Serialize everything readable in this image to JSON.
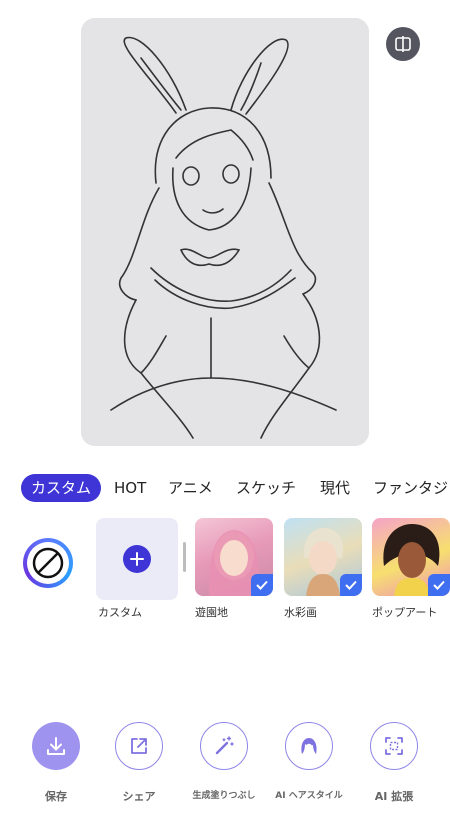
{
  "tabs": [
    {
      "label": "カスタム",
      "active": true
    },
    {
      "label": "HOT"
    },
    {
      "label": "アニメ"
    },
    {
      "label": "スケッチ"
    },
    {
      "label": "現代"
    },
    {
      "label": "ファンタジ"
    }
  ],
  "styles": {
    "none_icon": "no-style-icon",
    "custom_label": "カスタム",
    "items": [
      {
        "label": "遊園地",
        "selected": true
      },
      {
        "label": "水彩画",
        "selected": true
      },
      {
        "label": "ポップアート",
        "selected": true
      }
    ]
  },
  "actions": [
    {
      "label": "保存",
      "icon": "download-icon"
    },
    {
      "label": "シェア",
      "icon": "share-icon"
    },
    {
      "label": "生成塗りつぶし",
      "icon": "magic-wand-icon"
    },
    {
      "label": "AI ヘアスタイル",
      "icon": "hair-icon"
    },
    {
      "label": "AI 拡張",
      "icon": "expand-icon"
    }
  ],
  "colors": {
    "accent": "#3f35d6",
    "action_fill": "#9e94ef",
    "check": "#3f6ef0"
  }
}
